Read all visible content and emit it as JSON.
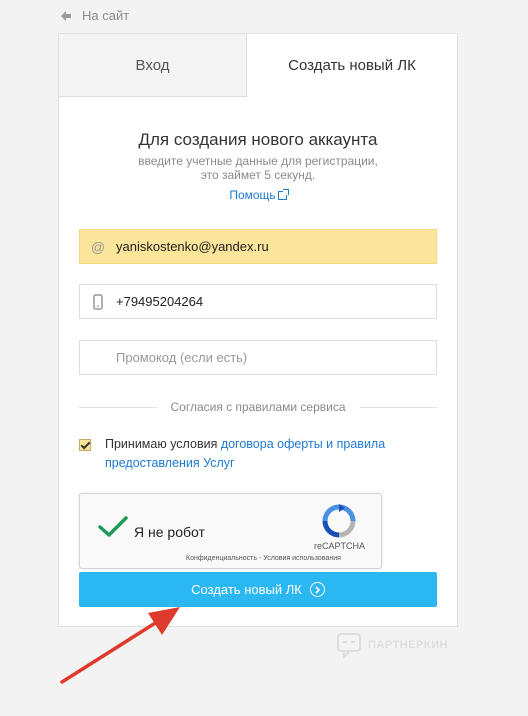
{
  "nav": {
    "back_label": "На сайт"
  },
  "tabs": [
    {
      "label": "Вход",
      "active": false
    },
    {
      "label": "Создать новый ЛК",
      "active": true
    }
  ],
  "form": {
    "heading": "Для создания нового аккаунта",
    "subtext_line1": "введите учетные данные для регистрации,",
    "subtext_line2": "это займет 5 секунд.",
    "help_label": "Помощь",
    "email_value": "yaniskostenko@yandex.ru",
    "phone_value": "+79495204264",
    "promo_placeholder": "Промокод (если есть)",
    "divider_label": "Согласия с правилами сервиса",
    "agree_prefix": "Принимаю условия ",
    "agree_link": "договора оферты и правила предоставления Услуг",
    "agree_checked": true,
    "submit_label": "Создать новый ЛК"
  },
  "captcha": {
    "label": "Я не робот",
    "brand": "reCAPTCHA",
    "terms": "Конфиденциальность - Условия использования",
    "checked": true
  },
  "watermark": {
    "text": "ПАРТНЕРКИН"
  },
  "colors": {
    "accent": "#2bb7f2",
    "link": "#1e7ad1",
    "autofill": "#fbe59b",
    "arrow": "#e03a2e",
    "check": "#1a9b5b"
  }
}
